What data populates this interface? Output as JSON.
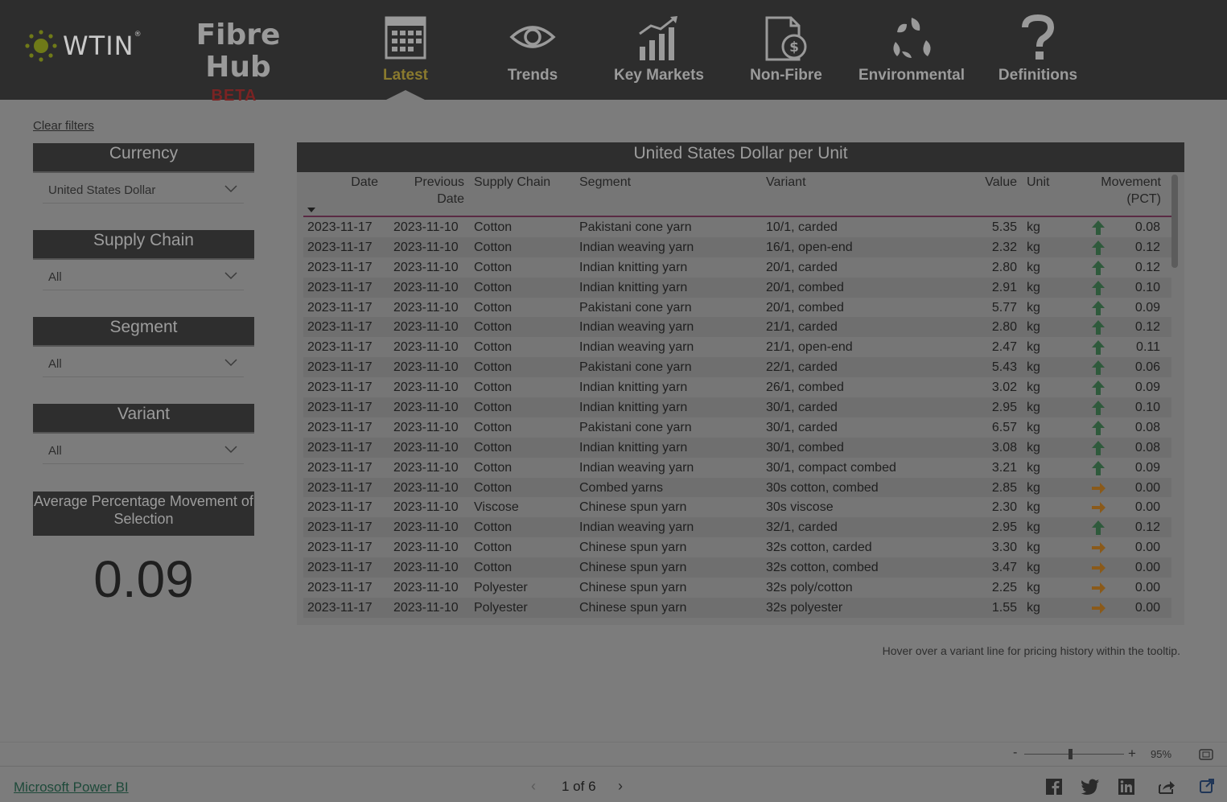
{
  "brand": {
    "logo_text": "WTIN",
    "logo_mark": "®",
    "title": "Fibre Hub",
    "badge": "BETA"
  },
  "nav": [
    {
      "label": "Latest",
      "icon": "calendar-icon",
      "active": true
    },
    {
      "label": "Trends",
      "icon": "eye-icon",
      "active": false
    },
    {
      "label": "Key Markets",
      "icon": "bar-chart-icon",
      "active": false
    },
    {
      "label": "Non-Fibre",
      "icon": "currency-document-icon",
      "active": false
    },
    {
      "label": "Environmental",
      "icon": "leaves-icon",
      "active": false
    },
    {
      "label": "Definitions",
      "icon": "question-mark-icon",
      "active": false
    }
  ],
  "filters": {
    "clear_label": "Clear filters",
    "currency": {
      "label": "Currency",
      "value": "United States Dollar"
    },
    "supply_chain": {
      "label": "Supply Chain",
      "value": "All"
    },
    "segment": {
      "label": "Segment",
      "value": "All"
    },
    "variant": {
      "label": "Variant",
      "value": "All"
    }
  },
  "average": {
    "label": "Average Percentage Movement of Selection",
    "value": "0.09"
  },
  "table": {
    "title": "United States Dollar per Unit",
    "columns": {
      "date": "Date",
      "previous_date_1": "Previous",
      "previous_date_2": "Date",
      "supply_chain": "Supply Chain",
      "segment": "Segment",
      "variant": "Variant",
      "value": "Value",
      "unit": "Unit",
      "movement_1": "Movement",
      "movement_2": "(PCT)"
    },
    "rows": [
      {
        "date": "2023-11-17",
        "prev": "2023-11-10",
        "chain": "Cotton",
        "segment": "Pakistani cone yarn",
        "variant": "10/1, carded",
        "value": "5.35",
        "unit": "kg",
        "dir": "up",
        "movement": "0.08"
      },
      {
        "date": "2023-11-17",
        "prev": "2023-11-10",
        "chain": "Cotton",
        "segment": "Indian weaving yarn",
        "variant": "16/1, open-end",
        "value": "2.32",
        "unit": "kg",
        "dir": "up",
        "movement": "0.12"
      },
      {
        "date": "2023-11-17",
        "prev": "2023-11-10",
        "chain": "Cotton",
        "segment": "Indian knitting yarn",
        "variant": "20/1, carded",
        "value": "2.80",
        "unit": "kg",
        "dir": "up",
        "movement": "0.12"
      },
      {
        "date": "2023-11-17",
        "prev": "2023-11-10",
        "chain": "Cotton",
        "segment": "Indian knitting yarn",
        "variant": "20/1, combed",
        "value": "2.91",
        "unit": "kg",
        "dir": "up",
        "movement": "0.10"
      },
      {
        "date": "2023-11-17",
        "prev": "2023-11-10",
        "chain": "Cotton",
        "segment": "Pakistani cone yarn",
        "variant": "20/1, combed",
        "value": "5.77",
        "unit": "kg",
        "dir": "up",
        "movement": "0.09"
      },
      {
        "date": "2023-11-17",
        "prev": "2023-11-10",
        "chain": "Cotton",
        "segment": "Indian weaving yarn",
        "variant": "21/1, carded",
        "value": "2.80",
        "unit": "kg",
        "dir": "up",
        "movement": "0.12"
      },
      {
        "date": "2023-11-17",
        "prev": "2023-11-10",
        "chain": "Cotton",
        "segment": "Indian weaving yarn",
        "variant": "21/1, open-end",
        "value": "2.47",
        "unit": "kg",
        "dir": "up",
        "movement": "0.11"
      },
      {
        "date": "2023-11-17",
        "prev": "2023-11-10",
        "chain": "Cotton",
        "segment": "Pakistani cone yarn",
        "variant": "22/1, carded",
        "value": "5.43",
        "unit": "kg",
        "dir": "up",
        "movement": "0.06"
      },
      {
        "date": "2023-11-17",
        "prev": "2023-11-10",
        "chain": "Cotton",
        "segment": "Indian knitting yarn",
        "variant": "26/1, combed",
        "value": "3.02",
        "unit": "kg",
        "dir": "up",
        "movement": "0.09"
      },
      {
        "date": "2023-11-17",
        "prev": "2023-11-10",
        "chain": "Cotton",
        "segment": "Indian knitting yarn",
        "variant": "30/1, carded",
        "value": "2.95",
        "unit": "kg",
        "dir": "up",
        "movement": "0.10"
      },
      {
        "date": "2023-11-17",
        "prev": "2023-11-10",
        "chain": "Cotton",
        "segment": "Pakistani cone yarn",
        "variant": "30/1, carded",
        "value": "6.57",
        "unit": "kg",
        "dir": "up",
        "movement": "0.08"
      },
      {
        "date": "2023-11-17",
        "prev": "2023-11-10",
        "chain": "Cotton",
        "segment": "Indian knitting yarn",
        "variant": "30/1, combed",
        "value": "3.08",
        "unit": "kg",
        "dir": "up",
        "movement": "0.08"
      },
      {
        "date": "2023-11-17",
        "prev": "2023-11-10",
        "chain": "Cotton",
        "segment": "Indian weaving yarn",
        "variant": "30/1, compact combed",
        "value": "3.21",
        "unit": "kg",
        "dir": "up",
        "movement": "0.09"
      },
      {
        "date": "2023-11-17",
        "prev": "2023-11-10",
        "chain": "Cotton",
        "segment": "Combed yarns",
        "variant": "30s cotton, combed",
        "value": "2.85",
        "unit": "kg",
        "dir": "flat",
        "movement": "0.00"
      },
      {
        "date": "2023-11-17",
        "prev": "2023-11-10",
        "chain": "Viscose",
        "segment": "Chinese spun yarn",
        "variant": "30s viscose",
        "value": "2.30",
        "unit": "kg",
        "dir": "flat",
        "movement": "0.00"
      },
      {
        "date": "2023-11-17",
        "prev": "2023-11-10",
        "chain": "Cotton",
        "segment": "Indian weaving yarn",
        "variant": "32/1, carded",
        "value": "2.95",
        "unit": "kg",
        "dir": "up",
        "movement": "0.12"
      },
      {
        "date": "2023-11-17",
        "prev": "2023-11-10",
        "chain": "Cotton",
        "segment": "Chinese spun yarn",
        "variant": "32s cotton, carded",
        "value": "3.30",
        "unit": "kg",
        "dir": "flat",
        "movement": "0.00"
      },
      {
        "date": "2023-11-17",
        "prev": "2023-11-10",
        "chain": "Cotton",
        "segment": "Chinese spun yarn",
        "variant": "32s cotton, combed",
        "value": "3.47",
        "unit": "kg",
        "dir": "flat",
        "movement": "0.00"
      },
      {
        "date": "2023-11-17",
        "prev": "2023-11-10",
        "chain": "Polyester",
        "segment": "Chinese spun yarn",
        "variant": "32s poly/cotton",
        "value": "2.25",
        "unit": "kg",
        "dir": "flat",
        "movement": "0.00"
      },
      {
        "date": "2023-11-17",
        "prev": "2023-11-10",
        "chain": "Polyester",
        "segment": "Chinese spun yarn",
        "variant": "32s polyester",
        "value": "1.55",
        "unit": "kg",
        "dir": "flat",
        "movement": "0.00"
      }
    ]
  },
  "tooltip_note": "Hover over a variant line for pricing history within the tooltip.",
  "zoom": {
    "minus": "-",
    "plus": "+",
    "percent": "95%"
  },
  "footer": {
    "powerbi": "Microsoft Power BI",
    "page_indicator": "1 of 6",
    "share_icons": [
      "facebook-icon",
      "twitter-icon",
      "linkedin-icon",
      "share-icon",
      "open-external-icon"
    ]
  },
  "colors": {
    "up_arrow": "#2f5a3c",
    "flat_arrow": "#8a5a1a",
    "active_nav": "#8a7a2e",
    "beta": "#7a2323"
  }
}
